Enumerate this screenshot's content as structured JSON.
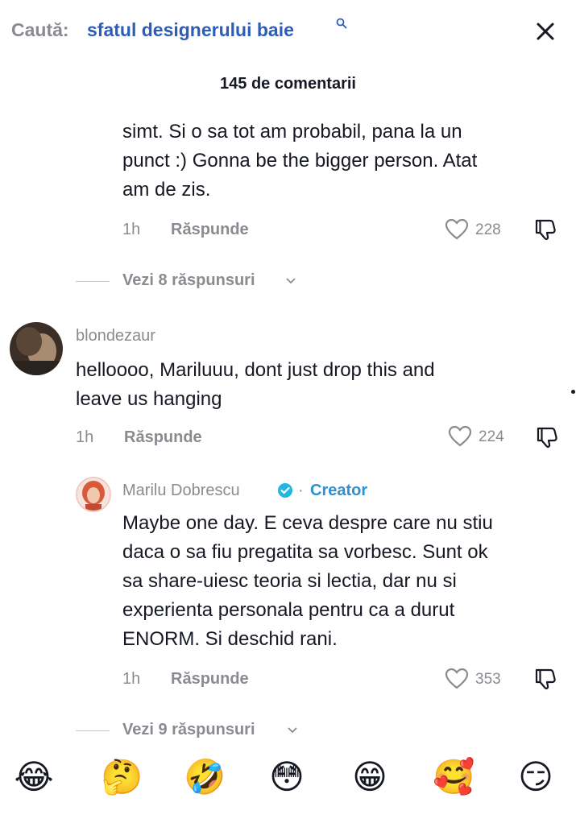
{
  "search": {
    "label": "Caută:",
    "query": "sfatul designerului baie"
  },
  "comments_header": {
    "count_text": "145 de comentarii"
  },
  "comment_1": {
    "lines": [
      "simt. Si o sa tot am probabil, pana la un",
      "punct :) Gonna be the bigger person. Atat",
      "am de zis."
    ],
    "time": "1h",
    "reply_label": "Răspunde",
    "likes": "228",
    "view_replies": "Vezi 8 răspunsuri"
  },
  "comment_2": {
    "username": "blondezaur",
    "lines": [
      "helloooo, Mariluuu, dont just drop this and",
      "leave us hanging"
    ],
    "time": "1h",
    "reply_label": "Răspunde",
    "likes": "224"
  },
  "reply_1": {
    "username": "Marilu Dobrescu",
    "separator": "·",
    "badge": "Creator",
    "lines": [
      "Maybe one day. E ceva despre care nu stiu",
      "daca o sa fiu pregatita sa vorbesc. Sunt ok",
      "sa share-uiesc teoria si lectia, dar nu si",
      "experienta personala pentru ca a durut",
      "ENORM. Si deschid rani."
    ],
    "time": "1h",
    "reply_label": "Răspunde",
    "likes": "353",
    "view_replies": "Vezi 9 răspunsuri"
  },
  "emoji_bar": [
    "😂",
    "🤔",
    "🤣",
    "😳",
    "😁",
    "🥰",
    "😏"
  ],
  "colors": {
    "text": "#161823",
    "muted": "#8a8b91",
    "query_blue": "#2b5db9",
    "creator_blue": "#2f8fcf"
  }
}
